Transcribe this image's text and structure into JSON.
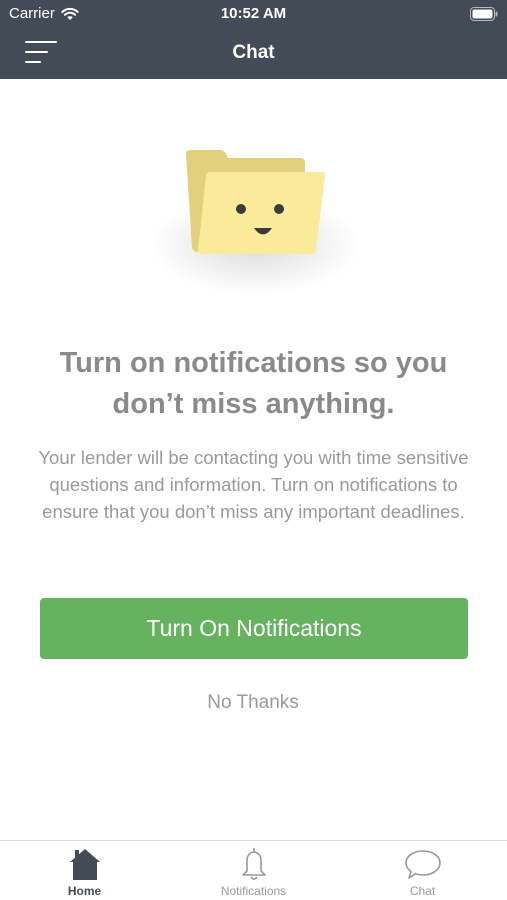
{
  "status_bar": {
    "carrier": "Carrier",
    "time": "10:52 AM",
    "icons": [
      "wifi-icon",
      "battery-icon"
    ]
  },
  "header": {
    "title": "Chat",
    "menu_icon": "hamburger-menu-icon"
  },
  "colors": {
    "header_bg": "#434b57",
    "accent_green": "#66b35f",
    "folder_back": "#e3d07c",
    "folder_front": "#faeb9a",
    "text_muted": "#9a9a9a",
    "tab_active": "#434b57"
  },
  "main": {
    "illustration": "smiling-folder-icon",
    "headline": "Turn on notifications so you don’t miss anything.",
    "body": "Your lender will be contacting you with time sensitive questions and information. Turn on notifications to ensure that you don’t miss any important deadlines.",
    "primary_button": "Turn On Notifications",
    "secondary_button": "No Thanks"
  },
  "tabbar": {
    "tabs": [
      {
        "label": "Home",
        "icon": "home-icon",
        "active": true
      },
      {
        "label": "Notifications",
        "icon": "bell-icon",
        "active": false
      },
      {
        "label": "Chat",
        "icon": "chat-bubble-icon",
        "active": false
      }
    ]
  }
}
